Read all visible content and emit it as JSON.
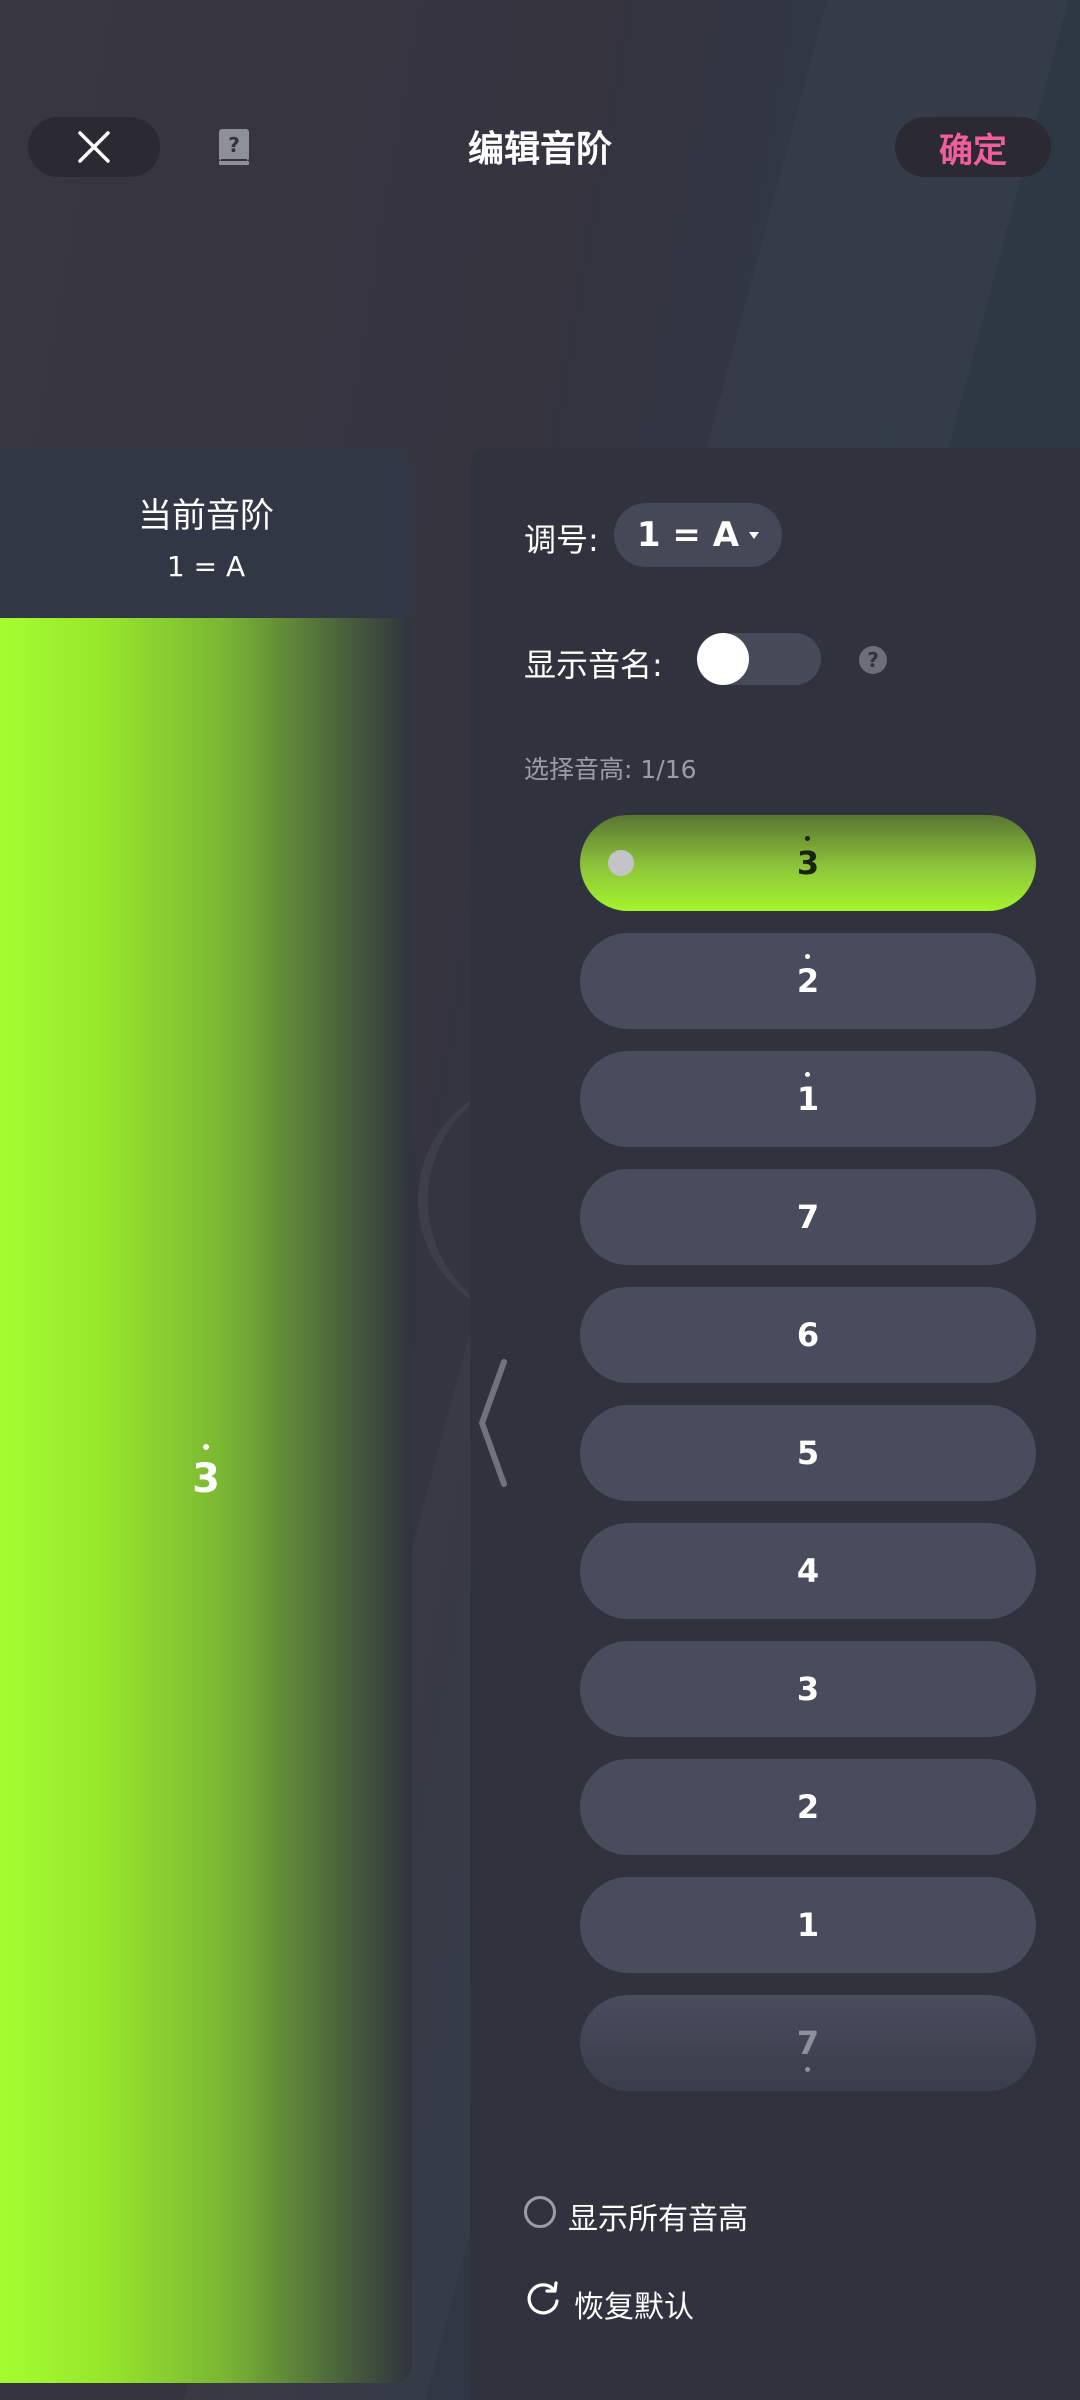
{
  "header": {
    "title": "编辑音阶",
    "confirm_label": "确定"
  },
  "left_panel": {
    "title": "当前音阶",
    "key": "1 = A",
    "current_note": "3"
  },
  "settings": {
    "key_label": "调号:",
    "key_value": "1 = A",
    "show_names_label": "显示音名:",
    "show_names_on": false,
    "help_glyph": "?",
    "pitch_label": "选择音高: 1/16"
  },
  "pitches": [
    {
      "note": "3",
      "octave": "high",
      "selected": true
    },
    {
      "note": "2",
      "octave": "high",
      "selected": false
    },
    {
      "note": "1",
      "octave": "high",
      "selected": false
    },
    {
      "note": "7",
      "octave": "mid",
      "selected": false
    },
    {
      "note": "6",
      "octave": "mid",
      "selected": false
    },
    {
      "note": "5",
      "octave": "mid",
      "selected": false
    },
    {
      "note": "4",
      "octave": "mid",
      "selected": false
    },
    {
      "note": "3",
      "octave": "mid",
      "selected": false
    },
    {
      "note": "2",
      "octave": "mid",
      "selected": false
    },
    {
      "note": "1",
      "octave": "mid",
      "selected": false
    },
    {
      "note": "7",
      "octave": "low",
      "selected": false
    }
  ],
  "footer": {
    "show_all_label": "显示所有音高",
    "reset_label": "恢复默认"
  },
  "colors": {
    "accent_pink": "#f05e9e",
    "accent_green": "#a4fd2e",
    "panel": "#30333e",
    "pill": "#484c5d"
  }
}
